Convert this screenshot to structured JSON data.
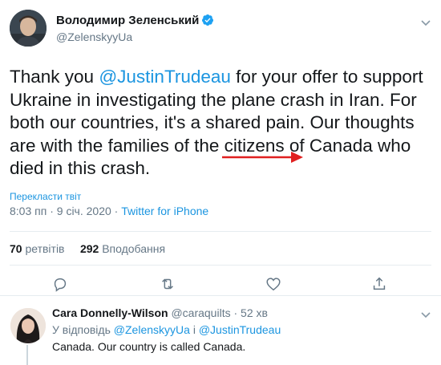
{
  "tweet": {
    "author_name": "Володимир Зеленський",
    "author_handle": "@ZelenskyyUa",
    "verified": true,
    "text_part1": "Thank you ",
    "mention": "@JustinTrudeau",
    "text_part2": " for your offer to support Ukraine in investigating the plane crash in Iran. For both our countries, it's a shared pain. Our thoughts are with the families of the citizens of Canada who died in this crash.",
    "translate_label": "Перекласти твіт",
    "time": "8:03 пп",
    "date_sep": "·",
    "date": "9 січ. 2020",
    "client_sep": "·",
    "client": "Twitter for iPhone",
    "retweets_count": "70",
    "retweets_label": "ретвітів",
    "likes_count": "292",
    "likes_label": "Вподобання",
    "accent_color": "#1b95e0",
    "annotation_arrow_color": "#e02020"
  },
  "actions": {
    "reply_icon": "reply-icon",
    "retweet_icon": "retweet-icon",
    "like_icon": "like-icon",
    "share_icon": "share-icon"
  },
  "reply": {
    "author_name": "Cara Donnelly-Wilson",
    "author_handle": "@caraquilts",
    "time_sep": "·",
    "time": "52 хв",
    "replying_to_prefix": "У відповідь",
    "replying_to_1": "@ZelenskyyUa",
    "replying_to_joiner": "і",
    "replying_to_2": "@JustinTrudeau",
    "text": "Canada. Our country is called Canada."
  }
}
